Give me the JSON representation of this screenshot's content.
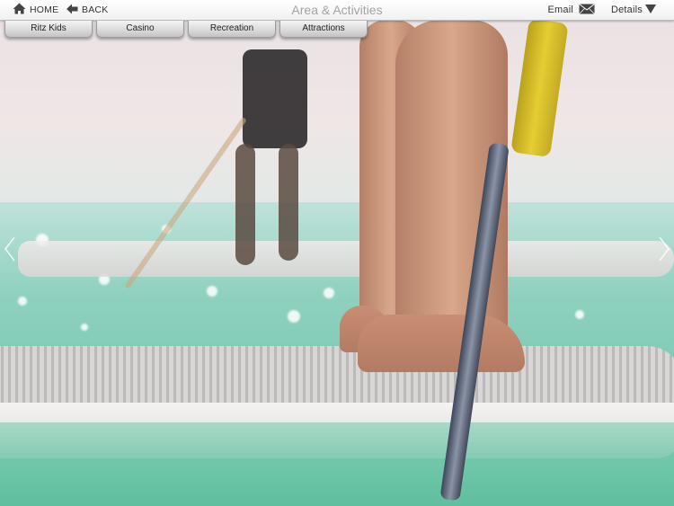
{
  "header": {
    "title": "Area & Activities",
    "home_label": "HOME",
    "back_label": "BACK",
    "email_label": "Email",
    "details_label": "Details"
  },
  "tabs": [
    {
      "label": "Ritz Kids"
    },
    {
      "label": "Casino"
    },
    {
      "label": "Recreation"
    },
    {
      "label": "Attractions"
    }
  ],
  "icons": {
    "home": "home-icon",
    "back": "back-arrow-icon",
    "email": "envelope-icon",
    "details": "triangle-down-icon",
    "prev": "chevron-left-icon",
    "next": "chevron-right-icon"
  },
  "colors": {
    "title": "#a3a3a3",
    "bar_text": "#333333",
    "tab_bg": "#d9d9d9"
  }
}
